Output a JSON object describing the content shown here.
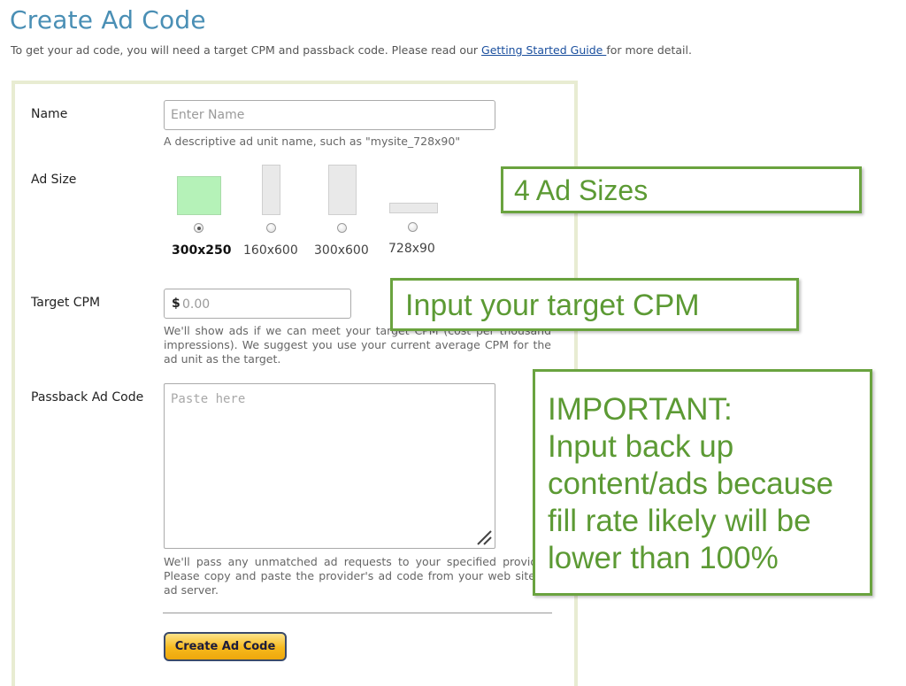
{
  "page": {
    "title": "Create Ad Code",
    "intro_text": "To get your ad code, you will need a target CPM and passback code. Please read our ",
    "intro_link": "Getting Started Guide ",
    "intro_suffix": "for more detail."
  },
  "form": {
    "name": {
      "label": "Name",
      "placeholder": "Enter Name",
      "value": "",
      "hint": "A descriptive ad unit name, such as \"mysite_728x90\""
    },
    "ad_size": {
      "label": "Ad Size",
      "selected": "300x250",
      "options": [
        {
          "label": "300x250",
          "selected": true
        },
        {
          "label": "160x600",
          "selected": false
        },
        {
          "label": "300x600",
          "selected": false
        },
        {
          "label": "728x90",
          "selected": false
        }
      ]
    },
    "target_cpm": {
      "label": "Target CPM",
      "currency_symbol": "$",
      "placeholder": "0.00",
      "value": "",
      "hint": "We'll show ads if we can meet your target CPM (cost per thousand impressions). We suggest you use your current average CPM for the ad unit as the target."
    },
    "passback": {
      "label": "Passback Ad Code",
      "placeholder": "Paste here",
      "value": "",
      "hint": "We'll pass any unmatched ad requests to your specified provider. Please copy and paste the provider's ad code from your web site or ad server."
    },
    "submit_label": "Create Ad Code"
  },
  "annotations": {
    "ad_sizes": "4 Ad Sizes",
    "target_cpm": "Input your target CPM",
    "important_lines": [
      "IMPORTANT:",
      "Input back up",
      "content/ads because",
      "fill rate likely will be",
      "lower than 100%"
    ]
  },
  "colors": {
    "title": "#4a8fb5",
    "link": "#1a4f9e",
    "panel_border": "#e8ecd2",
    "selected_size": "#b5f2b8",
    "annotation_green": "#6aa33f",
    "button_gold": "#f6b91c"
  }
}
